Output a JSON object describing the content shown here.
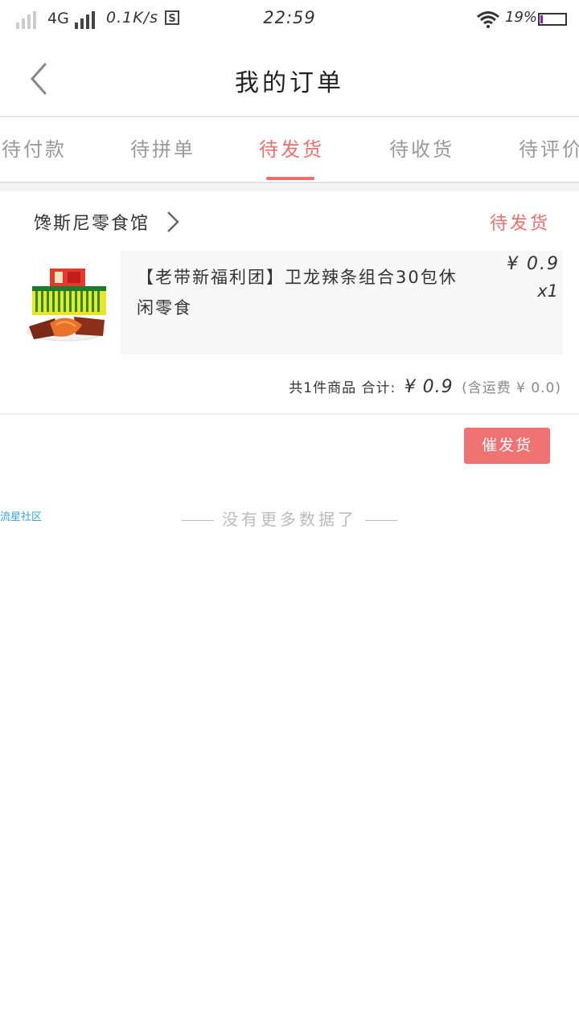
{
  "status_bar": {
    "network": "4G",
    "speed": "0.1K/s",
    "s_badge": "S",
    "time": "22:59",
    "battery_pct": "19%"
  },
  "header": {
    "title": "我的订单"
  },
  "tabs": [
    {
      "label": "待付款",
      "active": false
    },
    {
      "label": "待拼单",
      "active": false
    },
    {
      "label": "待发货",
      "active": true
    },
    {
      "label": "待收货",
      "active": false
    },
    {
      "label": "待评价",
      "active": false
    }
  ],
  "order": {
    "shop_name": "馋斯尼零食馆",
    "status": "待发货",
    "product": {
      "name": "【老带新福利团】卫龙辣条组合30包休闲零食",
      "price": "¥ 0.9",
      "quantity": "x1"
    },
    "summary": {
      "count_text": "共1件商品",
      "total_label": "合计:",
      "total_amount": "¥ 0.9",
      "shipping": "(含运费 ¥ 0.0)"
    },
    "action_label": "催发货"
  },
  "footer": {
    "no_more": "没有更多数据了",
    "watermark": "流星社区"
  },
  "colors": {
    "accent": "#ef6f6c",
    "button": "#ef7373"
  }
}
